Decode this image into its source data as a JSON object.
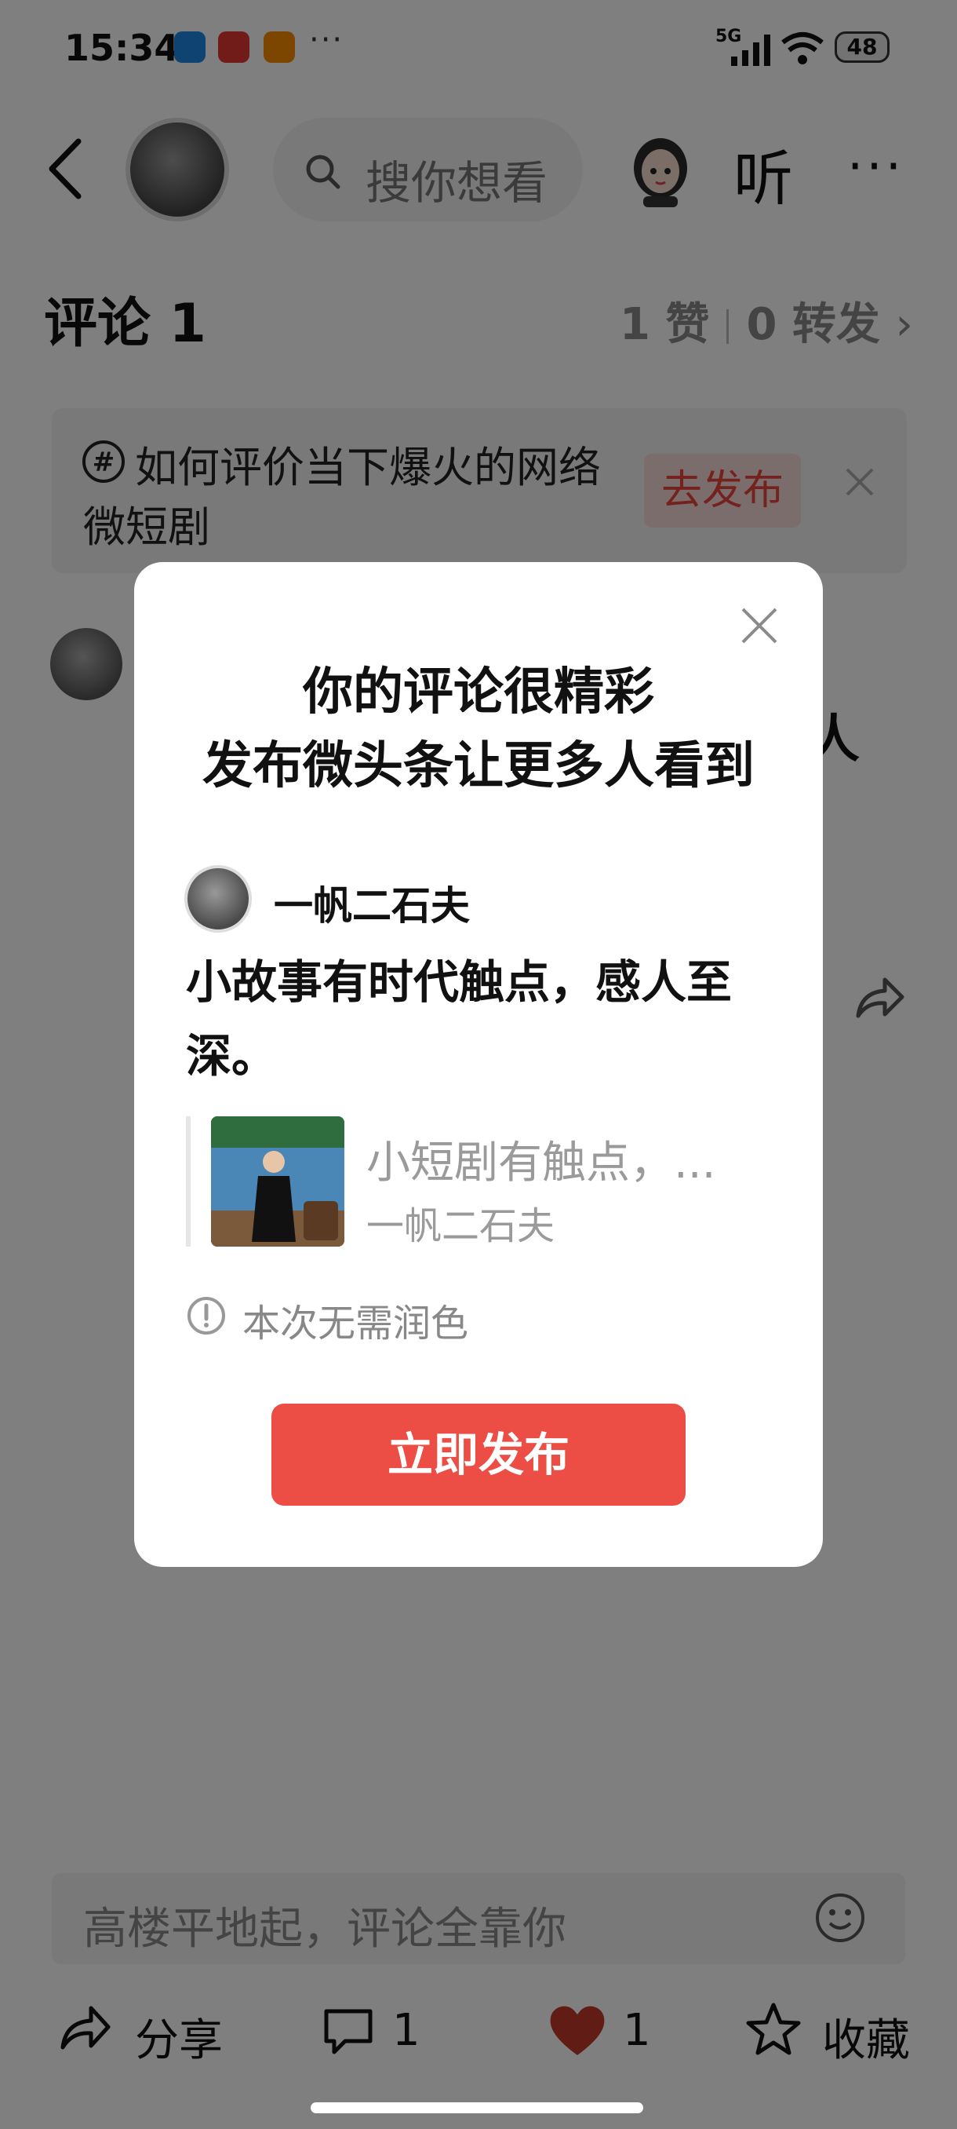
{
  "status_bar": {
    "time": "15:34",
    "network": "5G",
    "battery": "48",
    "more": "···"
  },
  "header": {
    "search_placeholder": "搜你想看",
    "listen_label": "听",
    "more_label": "···"
  },
  "comments": {
    "title": "评论 1",
    "likes": "1 赞",
    "forwards": "0 转发",
    "chevron": "›"
  },
  "topic": {
    "text": "如何评价当下爆火的网络微短剧",
    "publish_label": "去发布"
  },
  "comment_peek": {
    "text": "人"
  },
  "modal": {
    "title_line1": "你的评论很精彩",
    "title_line2": "发布微头条让更多人看到",
    "author": "一帆二石夫",
    "body": "小故事有时代触点，感人至深。",
    "quote_title": "小短剧有触点，...",
    "quote_author": "一帆二石夫",
    "info": "本次无需润色",
    "button": "立即发布"
  },
  "input_bar": {
    "placeholder": "高楼平地起，评论全靠你"
  },
  "bottom_bar": {
    "share": "分享",
    "comment_count": "1",
    "like_count": "1",
    "favorite": "收藏"
  },
  "colors": {
    "accent_red": "#ec4d45",
    "overlay": "rgba(0,0,0,0.5)"
  }
}
